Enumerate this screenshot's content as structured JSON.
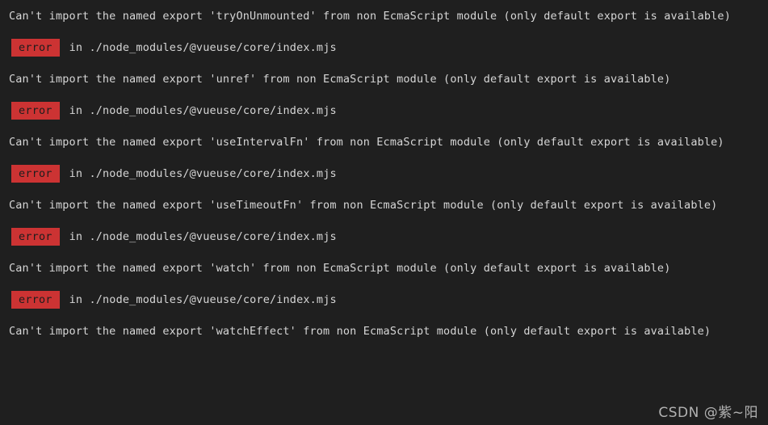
{
  "terminal": {
    "background_color": "#1f1f1f",
    "text_color": "#d6d6d6",
    "badge_color": "#cc3333",
    "badge_text_color": "#1d1d1d",
    "blocks": [
      {
        "type": "message",
        "text": "Can't import the named export 'tryOnUnmounted' from non EcmaScript module (only default export is available)"
      },
      {
        "type": "error",
        "badge": "error",
        "path": "in ./node_modules/@vueuse/core/index.mjs"
      },
      {
        "type": "message",
        "text": "Can't import the named export 'unref' from non EcmaScript module (only default export is available)"
      },
      {
        "type": "error",
        "badge": "error",
        "path": "in ./node_modules/@vueuse/core/index.mjs"
      },
      {
        "type": "message",
        "text": "Can't import the named export 'useIntervalFn' from non EcmaScript module (only default export is available)"
      },
      {
        "type": "error",
        "badge": "error",
        "path": "in ./node_modules/@vueuse/core/index.mjs"
      },
      {
        "type": "message",
        "text": "Can't import the named export 'useTimeoutFn' from non EcmaScript module (only default export is available)"
      },
      {
        "type": "error",
        "badge": "error",
        "path": "in ./node_modules/@vueuse/core/index.mjs"
      },
      {
        "type": "message",
        "text": "Can't import the named export 'watch' from non EcmaScript module (only default export is available)"
      },
      {
        "type": "error",
        "badge": "error",
        "path": "in ./node_modules/@vueuse/core/index.mjs"
      },
      {
        "type": "message",
        "text": "Can't import the named export 'watchEffect' from non EcmaScript module (only default export is available)"
      }
    ]
  },
  "watermark": {
    "text": "CSDN @紫~阳"
  }
}
